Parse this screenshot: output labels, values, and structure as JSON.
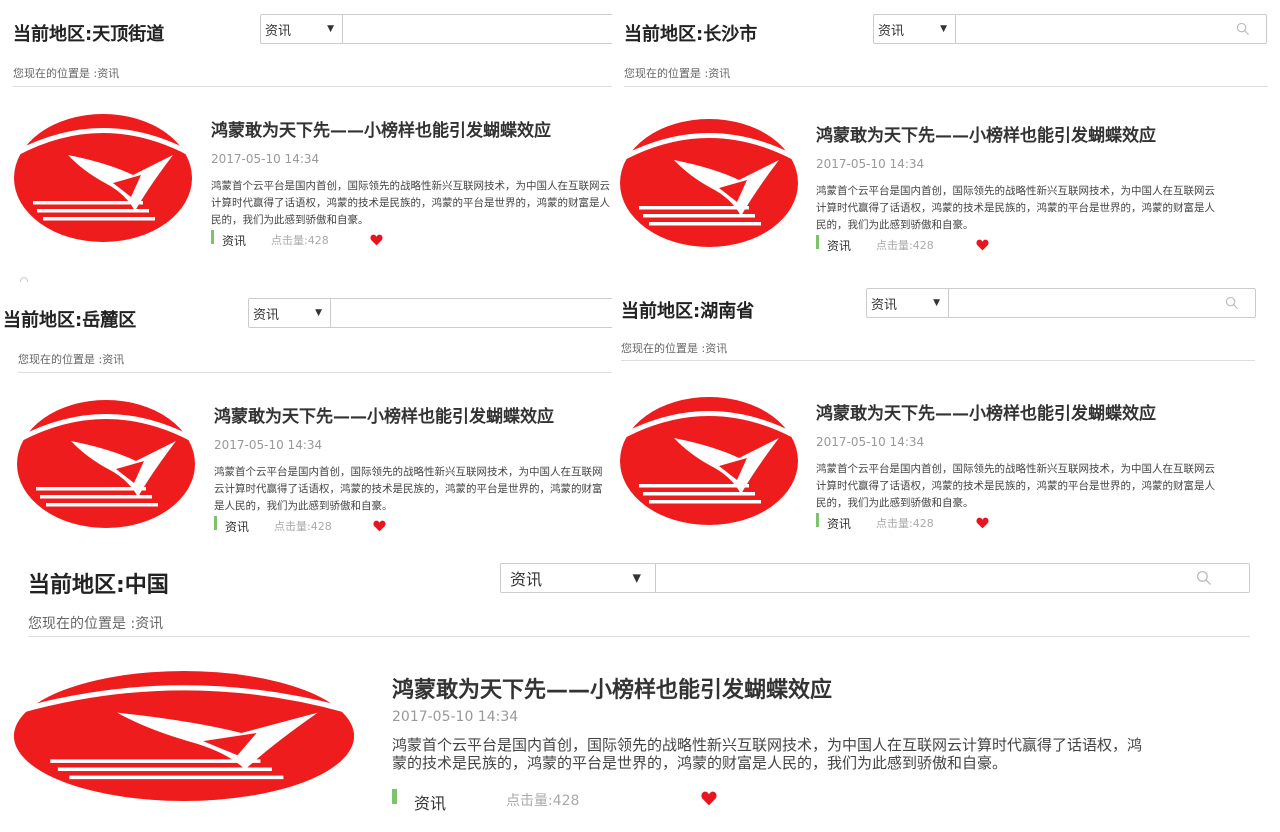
{
  "search": {
    "category": "资讯"
  },
  "breadcrumb": "您现在的位置是 :资讯",
  "article": {
    "title": "鸿蒙敢为天下先——小榜样也能引发蝴蝶效应",
    "date": "2017-05-10 14:34",
    "summary": "鸿蒙首个云平台是国内首创，国际领先的战略性新兴互联网技术，为中国人在互联网云计算时代赢得了话语权，鸿蒙的技术是民族的，鸿蒙的平台是世界的，鸿蒙的财富是人民的，我们为此感到骄傲和自豪。",
    "tag": "资讯",
    "clicks": "点击量:428"
  },
  "panels": [
    {
      "region": "当前地区:天顶街道"
    },
    {
      "region": "当前地区:长沙市"
    },
    {
      "region": "当前地区:岳麓区"
    },
    {
      "region": "当前地区:湖南省"
    },
    {
      "region": "当前地区:中国"
    }
  ],
  "colors": {
    "logo_red": "#ee1c1c",
    "tag_green": "#7dc36b",
    "heart": "#e8141e"
  }
}
